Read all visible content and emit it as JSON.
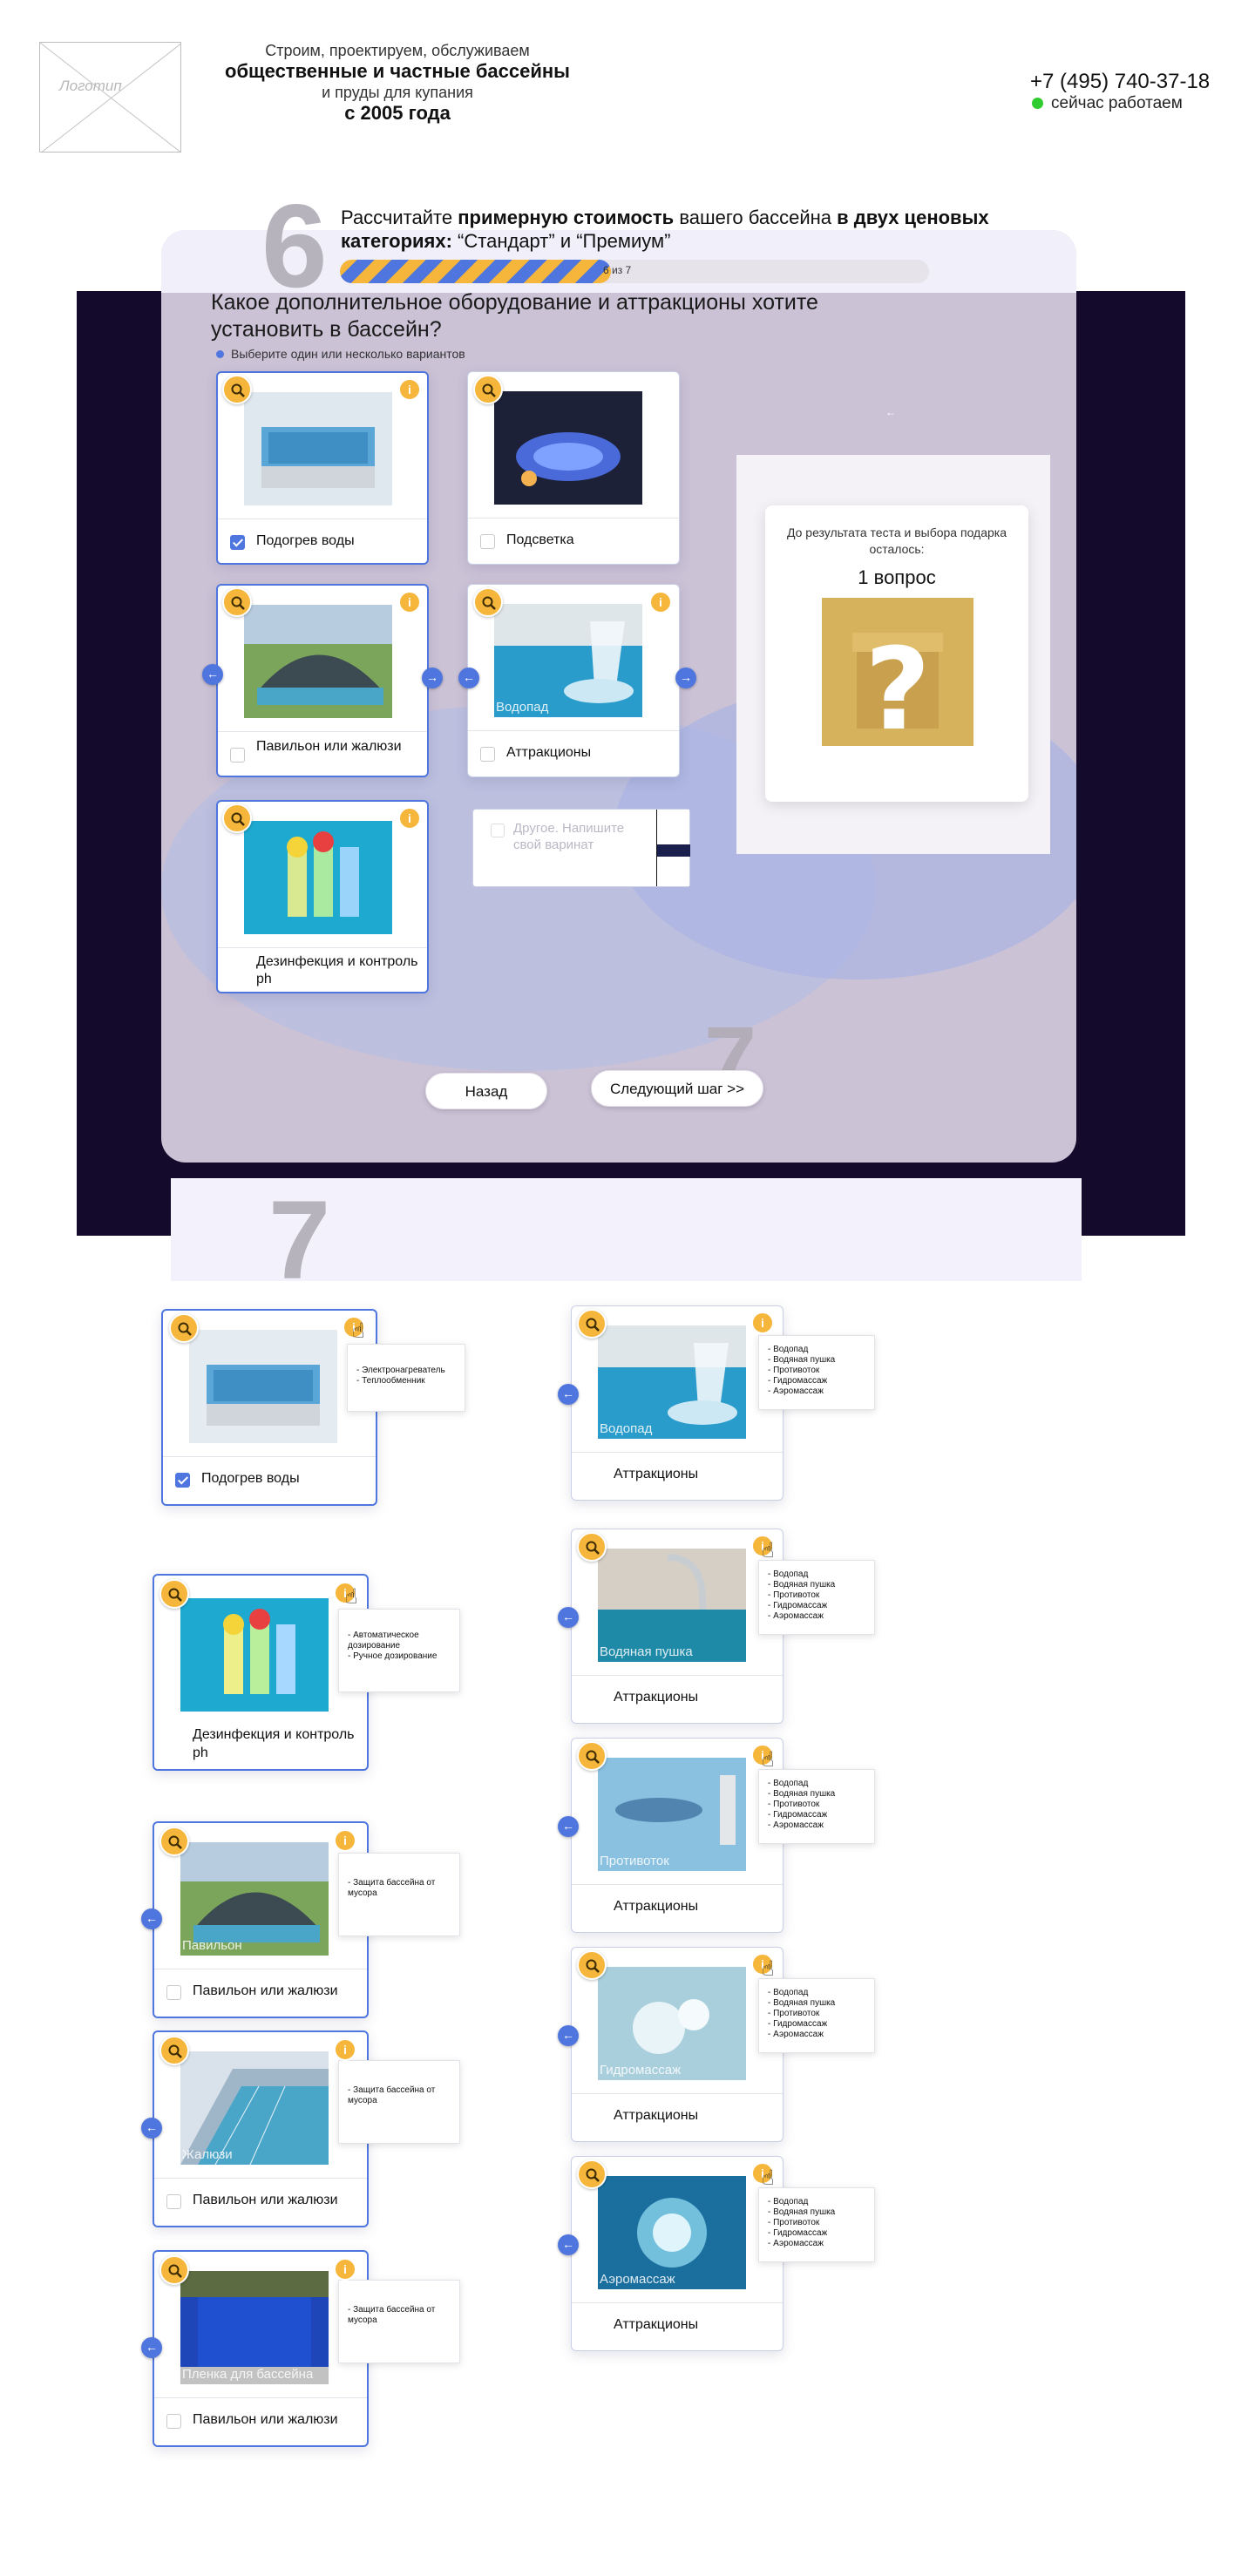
{
  "header": {
    "logo_text": "Логотип",
    "tagline_line1": "Строим, проектируем, обслуживаем",
    "tagline_line2": "общественные и частные бассейны",
    "tagline_line3": "и пруды для купания",
    "tagline_line4": "с 2005 года",
    "phone": "+7 (495) 740-37-18",
    "status": "сейчас работаем",
    "status_color": "#2ecc2e"
  },
  "quiz": {
    "step_number": "6",
    "next_step_number": "7",
    "title_prefix": "Рассчитайте ",
    "title_bold1": "примерную стоимость",
    "title_mid": " вашего бассейна ",
    "title_bold2": "в двух ценовых категориях:",
    "title_suffix": " “Стандарт” и “Премиум”",
    "progress_text": "6 из 7",
    "progress_fraction": 0.46,
    "question": "Какое дополнительное оборудование и аттракционы хотите установить в бассейн?",
    "hint": "Выберите один или несколько вариантов",
    "options": [
      {
        "label": "Подогрев воды",
        "checked": true,
        "icon": "pool-heater-image"
      },
      {
        "label": "Подсветка",
        "checked": false,
        "icon": "pool-lights-image"
      },
      {
        "label": "Павильон или жалюзи",
        "checked": false,
        "icon": "pavilion-image"
      },
      {
        "label": "Аттракционы",
        "checked": false,
        "icon": "waterfall-image",
        "caption": "Водопад"
      },
      {
        "label": "Дезинфекция и контроль ph",
        "checked": false,
        "icon": "ph-test-image"
      }
    ],
    "other_placeholder": "Другое. Напишите свой варинат",
    "back_label": "Назад",
    "next_label": "Следующий шаг >>",
    "sidebar_text": "До результата теста  и выбора подарка осталось:",
    "sidebar_count": "1 вопрос",
    "accent_color": "#4f76df",
    "badge_color": "#f5b63b"
  },
  "variants": {
    "heating": {
      "label": "Подогрев воды",
      "tips": [
        "- Электронагреватель",
        "- Теплообменник"
      ]
    },
    "disinfection": {
      "label": "Дезинфекция и контроль ph",
      "tips": [
        "- Автоматическое",
        "дозирование",
        "- Ручное дозирование"
      ]
    },
    "pavilion_tips": [
      "- Защита  бассейна от",
      "мусора"
    ],
    "pavilions": [
      {
        "label": "Павильон или жалюзи",
        "caption": "Павильон"
      },
      {
        "label": "Павильон или жалюзи",
        "caption": "Жалюзи"
      },
      {
        "label": "Павильон или жалюзи",
        "caption": "Пленка для бассейна"
      }
    ],
    "attraction_tips": [
      "- Водопад",
      "- Водяная пушка",
      "- Противоток",
      "- Гидромассаж",
      "- Аэромассаж"
    ],
    "attractions": [
      {
        "label": "Аттракционы",
        "caption": "Водопад"
      },
      {
        "label": "Аттракционы",
        "caption": "Водяная пушка"
      },
      {
        "label": "Аттракционы",
        "caption": "Противоток"
      },
      {
        "label": "Аттракционы",
        "caption": "Гидромассаж"
      },
      {
        "label": "Аттракционы",
        "caption": "Аэромассаж"
      }
    ]
  }
}
